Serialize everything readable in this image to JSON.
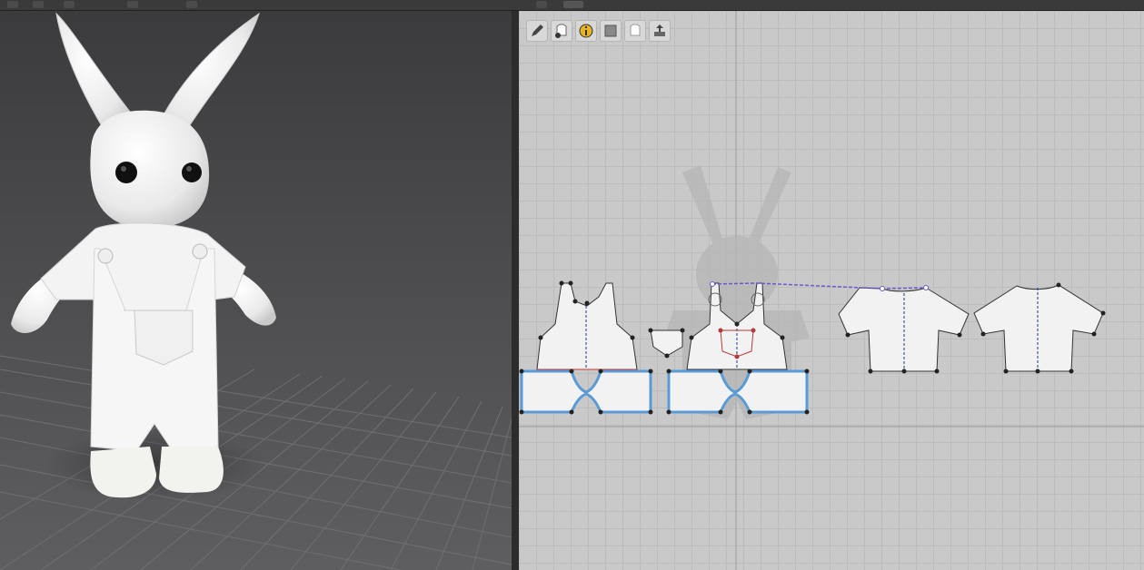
{
  "app": {
    "panes": [
      "3d-viewport",
      "2d-pattern-window"
    ]
  },
  "toolbar_3d_top": {
    "icons": [
      "menu-icon-1",
      "menu-icon-2",
      "menu-icon-3",
      "menu-icon-4",
      "menu-icon-5",
      "menu-icon-6",
      "menu-icon-7"
    ]
  },
  "toolbar_2d": {
    "tools": [
      {
        "name": "edit-pattern-tool",
        "icon": "pencil-icon"
      },
      {
        "name": "show-avatar-tool",
        "icon": "shirt-eye-icon"
      },
      {
        "name": "pattern-info-tool",
        "icon": "info-icon"
      },
      {
        "name": "sketch-book-tool",
        "icon": "book-icon"
      },
      {
        "name": "hide-garment-tool",
        "icon": "shirt-icon"
      },
      {
        "name": "export-tool",
        "icon": "export-icon"
      }
    ]
  },
  "scene_3d": {
    "avatar": "rabbit-avatar",
    "garment": "white-overalls-and-tshirt"
  },
  "colors": {
    "selection_blue": "#5b9bd5",
    "segment_purple": "#6a5acd",
    "pocket_red": "#b33a3a",
    "pattern_fill": "#f2f2f2"
  }
}
